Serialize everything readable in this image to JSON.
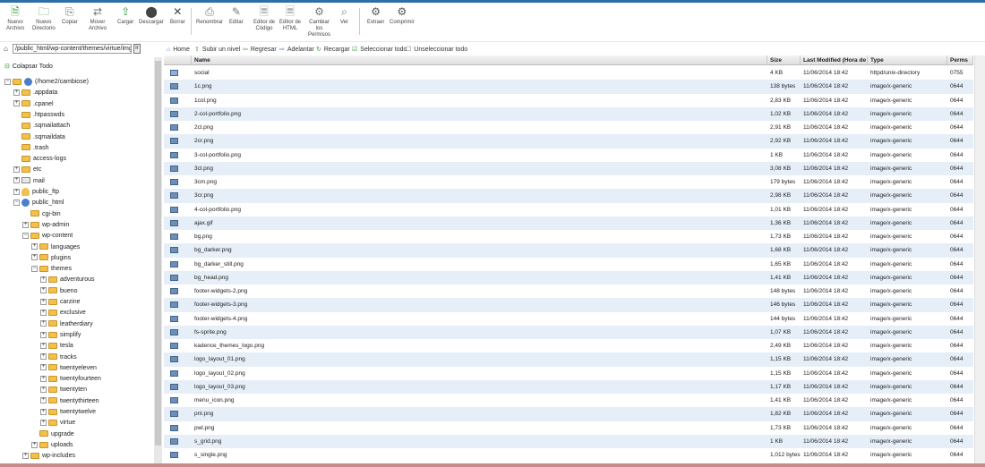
{
  "toolbar": {
    "buttons": [
      {
        "label": "Nuevo\nArchivo",
        "icon": "new-file-icon"
      },
      {
        "label": "Nuevo\nDirectorio",
        "icon": "new-folder-icon"
      },
      {
        "label": "Copiar",
        "icon": "copy-icon"
      },
      {
        "label": "Mover\nArchivo",
        "icon": "move-icon"
      },
      {
        "label": "Cargar",
        "icon": "upload-icon"
      },
      {
        "label": "Descargar",
        "icon": "download-icon"
      },
      {
        "label": "Borrar",
        "icon": "delete-icon"
      },
      {
        "label": "Renombrar",
        "icon": "rename-icon"
      },
      {
        "label": "Editar",
        "icon": "edit-icon"
      },
      {
        "label": "Editor de\nCódigo",
        "icon": "code-editor-icon"
      },
      {
        "label": "Editor de\nHTML",
        "icon": "html-editor-icon"
      },
      {
        "label": "Cambiar\nlos\nPermisos",
        "icon": "permissions-icon"
      },
      {
        "label": "Ver",
        "icon": "view-icon"
      },
      {
        "label": "Extraer",
        "icon": "extract-icon"
      },
      {
        "label": "Comprimir",
        "icon": "compress-icon"
      }
    ]
  },
  "path": {
    "value": "/public_html/wp-content/themes/virtue/img",
    "go": "Ir"
  },
  "nav": {
    "home": "Home",
    "up": "Subir un nivel",
    "back": "Regresar",
    "forward": "Adelantar",
    "reload": "Recargar",
    "select_all": "Seleccionar todo",
    "unselect_all": "Unseleccionar todo"
  },
  "sidebar": {
    "collapse": "Colapsar Todo",
    "tree": [
      {
        "label": "(/home2/cambiose)",
        "depth": 0,
        "exp": "-",
        "icon": "home"
      },
      {
        "label": ".appdata",
        "depth": 1,
        "exp": "+",
        "icon": "folder"
      },
      {
        "label": ".cpanel",
        "depth": 1,
        "exp": "+",
        "icon": "folder"
      },
      {
        "label": ".htpasswds",
        "depth": 1,
        "exp": "",
        "icon": "folder"
      },
      {
        "label": ".sqmailattach",
        "depth": 1,
        "exp": "",
        "icon": "folder"
      },
      {
        "label": ".sqmaildata",
        "depth": 1,
        "exp": "",
        "icon": "folder"
      },
      {
        "label": ".trash",
        "depth": 1,
        "exp": "",
        "icon": "folder"
      },
      {
        "label": "access-logs",
        "depth": 1,
        "exp": "",
        "icon": "folder"
      },
      {
        "label": "etc",
        "depth": 1,
        "exp": "+",
        "icon": "folder"
      },
      {
        "label": "mail",
        "depth": 1,
        "exp": "+",
        "icon": "mail"
      },
      {
        "label": "public_ftp",
        "depth": 1,
        "exp": "+",
        "icon": "ftp"
      },
      {
        "label": "public_html",
        "depth": 1,
        "exp": "-",
        "icon": "globe"
      },
      {
        "label": "cgi-bin",
        "depth": 2,
        "exp": "",
        "icon": "folder"
      },
      {
        "label": "wp-admin",
        "depth": 2,
        "exp": "+",
        "icon": "folder"
      },
      {
        "label": "wp-content",
        "depth": 2,
        "exp": "-",
        "icon": "folder"
      },
      {
        "label": "languages",
        "depth": 3,
        "exp": "+",
        "icon": "folder"
      },
      {
        "label": "plugins",
        "depth": 3,
        "exp": "+",
        "icon": "folder"
      },
      {
        "label": "themes",
        "depth": 3,
        "exp": "-",
        "icon": "folder"
      },
      {
        "label": "adventurous",
        "depth": 4,
        "exp": "+",
        "icon": "folder"
      },
      {
        "label": "bueno",
        "depth": 4,
        "exp": "+",
        "icon": "folder"
      },
      {
        "label": "carzine",
        "depth": 4,
        "exp": "+",
        "icon": "folder"
      },
      {
        "label": "exclusive",
        "depth": 4,
        "exp": "+",
        "icon": "folder"
      },
      {
        "label": "leatherdiary",
        "depth": 4,
        "exp": "+",
        "icon": "folder"
      },
      {
        "label": "simplify",
        "depth": 4,
        "exp": "+",
        "icon": "folder"
      },
      {
        "label": "tesla",
        "depth": 4,
        "exp": "+",
        "icon": "folder"
      },
      {
        "label": "tracks",
        "depth": 4,
        "exp": "+",
        "icon": "folder"
      },
      {
        "label": "twentyeleven",
        "depth": 4,
        "exp": "+",
        "icon": "folder"
      },
      {
        "label": "twentyfourteen",
        "depth": 4,
        "exp": "+",
        "icon": "folder"
      },
      {
        "label": "twentyten",
        "depth": 4,
        "exp": "+",
        "icon": "folder"
      },
      {
        "label": "twentythirteen",
        "depth": 4,
        "exp": "+",
        "icon": "folder"
      },
      {
        "label": "twentytwelve",
        "depth": 4,
        "exp": "+",
        "icon": "folder"
      },
      {
        "label": "virtue",
        "depth": 4,
        "exp": "+",
        "icon": "folder"
      },
      {
        "label": "upgrade",
        "depth": 3,
        "exp": "",
        "icon": "folder"
      },
      {
        "label": "uploads",
        "depth": 3,
        "exp": "+",
        "icon": "folder"
      },
      {
        "label": "wp-includes",
        "depth": 2,
        "exp": "+",
        "icon": "folder"
      }
    ]
  },
  "table": {
    "headers": {
      "name": "Name",
      "size": "Size",
      "modified": "Last Modified (Hora de v",
      "type": "Type",
      "perms": "Perms"
    },
    "rows": [
      {
        "name": "social",
        "size": "4 KB",
        "modified": "11/06/2014 18:42",
        "type": "httpd/unix-directory",
        "perms": "0755",
        "dir": true
      },
      {
        "name": "1c.png",
        "size": "138 bytes",
        "modified": "11/06/2014 18:42",
        "type": "image/x-generic",
        "perms": "0644"
      },
      {
        "name": "1col.png",
        "size": "2,83 KB",
        "modified": "11/06/2014 18:42",
        "type": "image/x-generic",
        "perms": "0644"
      },
      {
        "name": "2-col-portfolio.png",
        "size": "1,02 KB",
        "modified": "11/06/2014 18:42",
        "type": "image/x-generic",
        "perms": "0644"
      },
      {
        "name": "2cl.png",
        "size": "2,91 KB",
        "modified": "11/06/2014 18:42",
        "type": "image/x-generic",
        "perms": "0644"
      },
      {
        "name": "2cr.png",
        "size": "2,92 KB",
        "modified": "11/06/2014 18:42",
        "type": "image/x-generic",
        "perms": "0644"
      },
      {
        "name": "3-col-portfolio.png",
        "size": "1 KB",
        "modified": "11/06/2014 18:42",
        "type": "image/x-generic",
        "perms": "0644"
      },
      {
        "name": "3cl.png",
        "size": "3,08 KB",
        "modified": "11/06/2014 18:42",
        "type": "image/x-generic",
        "perms": "0644"
      },
      {
        "name": "3cm.png",
        "size": "179 bytes",
        "modified": "11/06/2014 18:42",
        "type": "image/x-generic",
        "perms": "0644"
      },
      {
        "name": "3cr.png",
        "size": "2,98 KB",
        "modified": "11/06/2014 18:42",
        "type": "image/x-generic",
        "perms": "0644"
      },
      {
        "name": "4-col-portfolio.png",
        "size": "1,01 KB",
        "modified": "11/06/2014 18:42",
        "type": "image/x-generic",
        "perms": "0644"
      },
      {
        "name": "ajax.gif",
        "size": "1,36 KB",
        "modified": "11/06/2014 18:42",
        "type": "image/x-generic",
        "perms": "0644"
      },
      {
        "name": "bg.png",
        "size": "1,73 KB",
        "modified": "11/06/2014 18:42",
        "type": "image/x-generic",
        "perms": "0644"
      },
      {
        "name": "bg_darker.png",
        "size": "1,68 KB",
        "modified": "11/06/2014 18:42",
        "type": "image/x-generic",
        "perms": "0644"
      },
      {
        "name": "bg_darker_still.png",
        "size": "1,65 KB",
        "modified": "11/06/2014 18:42",
        "type": "image/x-generic",
        "perms": "0644"
      },
      {
        "name": "bg_head.png",
        "size": "1,41 KB",
        "modified": "11/06/2014 18:42",
        "type": "image/x-generic",
        "perms": "0644"
      },
      {
        "name": "footer-widgets-2.png",
        "size": "148 bytes",
        "modified": "11/06/2014 18:42",
        "type": "image/x-generic",
        "perms": "0644"
      },
      {
        "name": "footer-widgets-3.png",
        "size": "146 bytes",
        "modified": "11/06/2014 18:42",
        "type": "image/x-generic",
        "perms": "0644"
      },
      {
        "name": "footer-widgets-4.png",
        "size": "144 bytes",
        "modified": "11/06/2014 18:42",
        "type": "image/x-generic",
        "perms": "0644"
      },
      {
        "name": "fs-sprite.png",
        "size": "1,07 KB",
        "modified": "11/06/2014 18:42",
        "type": "image/x-generic",
        "perms": "0644"
      },
      {
        "name": "kadence_themes_logo.png",
        "size": "2,49 KB",
        "modified": "11/06/2014 18:42",
        "type": "image/x-generic",
        "perms": "0644"
      },
      {
        "name": "logo_layout_01.png",
        "size": "1,15 KB",
        "modified": "11/06/2014 18:42",
        "type": "image/x-generic",
        "perms": "0644"
      },
      {
        "name": "logo_layout_02.png",
        "size": "1,15 KB",
        "modified": "11/06/2014 18:42",
        "type": "image/x-generic",
        "perms": "0644"
      },
      {
        "name": "logo_layout_03.png",
        "size": "1,17 KB",
        "modified": "11/06/2014 18:42",
        "type": "image/x-generic",
        "perms": "0644"
      },
      {
        "name": "menu_icon.png",
        "size": "1,41 KB",
        "modified": "11/06/2014 18:42",
        "type": "image/x-generic",
        "perms": "0644"
      },
      {
        "name": "pnl.png",
        "size": "1,82 KB",
        "modified": "11/06/2014 18:42",
        "type": "image/x-generic",
        "perms": "0644"
      },
      {
        "name": "pwl.png",
        "size": "1,73 KB",
        "modified": "11/06/2014 18:42",
        "type": "image/x-generic",
        "perms": "0644"
      },
      {
        "name": "s_grid.png",
        "size": "1 KB",
        "modified": "11/06/2014 18:42",
        "type": "image/x-generic",
        "perms": "0644"
      },
      {
        "name": "s_single.png",
        "size": "1,012 bytes",
        "modified": "11/06/2014 18:42",
        "type": "image/x-generic",
        "perms": "0644"
      }
    ]
  }
}
